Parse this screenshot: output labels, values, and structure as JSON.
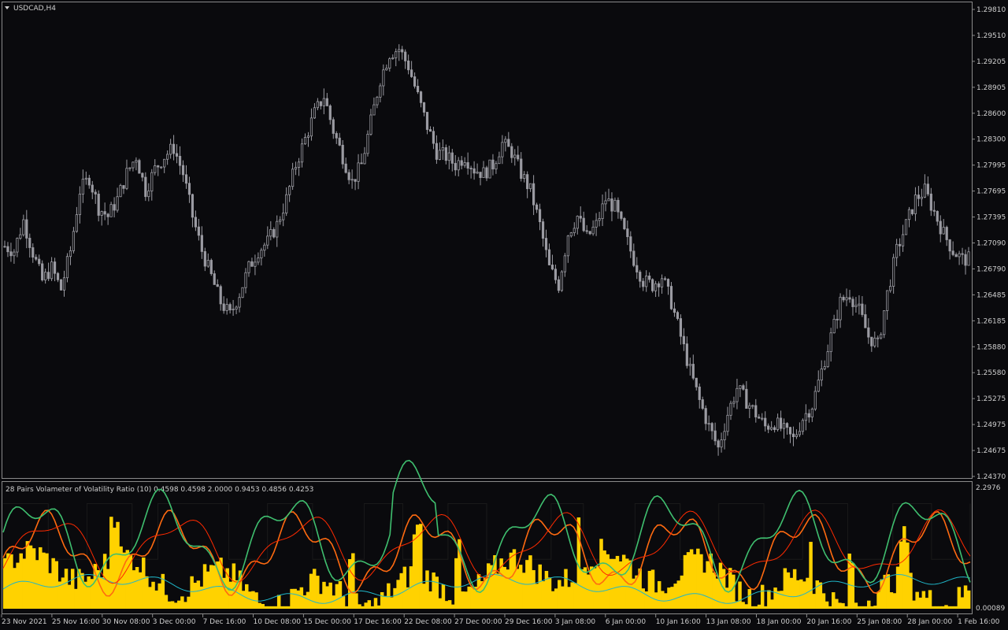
{
  "window": {
    "symbol_label": "USDCAD,H4",
    "menu_icon": "triangle-down-icon"
  },
  "colors": {
    "background": "#0a0a0d",
    "frame": "#8a8a8a",
    "candle": "#9b9ba2",
    "axis_text": "#cfcfcf",
    "histogram": "#ffd200",
    "line_green": "#3fbf6f",
    "line_red": "#ff2a00",
    "line_orange": "#ff6a10",
    "line_cyan": "#1fb6c8",
    "line_black": "#000000"
  },
  "price_panel": {
    "price_labels": [
      "1.29810",
      "1.29510",
      "1.29205",
      "1.28905",
      "1.28600",
      "1.28300",
      "1.27995",
      "1.27695",
      "1.27395",
      "1.27090",
      "1.26790",
      "1.26485",
      "1.26185",
      "1.25880",
      "1.25580",
      "1.25275",
      "1.24975",
      "1.24675",
      "1.24370"
    ]
  },
  "indicator_panel": {
    "title": "28 Pairs Volameter of Volatility Ratio (10) 0.4598 0.4598 2.0000 0.9453 0.4856 0.4253",
    "scale_top": "2.2976",
    "scale_bottom": "0.00089"
  },
  "time_axis": {
    "labels": [
      "23 Nov 2021",
      "25 Nov 16:00",
      "30 Nov 08:00",
      "3 Dec 00:00",
      "7 Dec 16:00",
      "10 Dec 08:00",
      "15 Dec 00:00",
      "17 Dec 16:00",
      "22 Dec 08:00",
      "27 Dec 00:00",
      "29 Dec 16:00",
      "3 Jan 08:00",
      "6 Jan 00:00",
      "10 Jan 16:00",
      "13 Jan 08:00",
      "18 Jan 00:00",
      "20 Jan 16:00",
      "25 Jan 08:00",
      "28 Jan 00:00",
      "1 Feb 16:00"
    ]
  },
  "chart_data": {
    "type": "candlestick",
    "title": "USDCAD,H4",
    "ylim": [
      1.2437,
      1.2981
    ],
    "price_path": [
      [
        0,
        1.2705
      ],
      [
        3,
        1.27
      ],
      [
        6,
        1.2735
      ],
      [
        9,
        1.2698
      ],
      [
        12,
        1.2665
      ],
      [
        15,
        1.268
      ],
      [
        18,
        1.2655
      ],
      [
        21,
        1.27
      ],
      [
        24,
        1.277
      ],
      [
        27,
        1.2785
      ],
      [
        30,
        1.275
      ],
      [
        33,
        1.274
      ],
      [
        36,
        1.276
      ],
      [
        39,
        1.279
      ],
      [
        42,
        1.281
      ],
      [
        45,
        1.277
      ],
      [
        48,
        1.2795
      ],
      [
        51,
        1.281
      ],
      [
        54,
        1.282
      ],
      [
        57,
        1.279
      ],
      [
        60,
        1.274
      ],
      [
        63,
        1.27
      ],
      [
        66,
        1.267
      ],
      [
        69,
        1.264
      ],
      [
        72,
        1.2625
      ],
      [
        75,
        1.265
      ],
      [
        78,
        1.268
      ],
      [
        81,
        1.27
      ],
      [
        84,
        1.271
      ],
      [
        87,
        1.273
      ],
      [
        90,
        1.276
      ],
      [
        93,
        1.28
      ],
      [
        96,
        1.283
      ],
      [
        99,
        1.286
      ],
      [
        102,
        1.288
      ],
      [
        105,
        1.284
      ],
      [
        108,
        1.281
      ],
      [
        111,
        1.278
      ],
      [
        114,
        1.28
      ],
      [
        117,
        1.285
      ],
      [
        120,
        1.29
      ],
      [
        123,
        1.293
      ],
      [
        126,
        1.2935
      ],
      [
        129,
        1.2915
      ],
      [
        132,
        1.288
      ],
      [
        135,
        1.2845
      ],
      [
        138,
        1.2815
      ],
      [
        141,
        1.281
      ],
      [
        144,
        1.28
      ],
      [
        147,
        1.281
      ],
      [
        150,
        1.2795
      ],
      [
        153,
        1.279
      ],
      [
        156,
        1.28
      ],
      [
        159,
        1.2825
      ],
      [
        162,
        1.2815
      ],
      [
        165,
        1.279
      ],
      [
        168,
        1.277
      ],
      [
        171,
        1.273
      ],
      [
        174,
        1.268
      ],
      [
        177,
        1.266
      ],
      [
        180,
        1.272
      ],
      [
        183,
        1.274
      ],
      [
        186,
        1.2715
      ],
      [
        189,
        1.273
      ],
      [
        192,
        1.276
      ],
      [
        195,
        1.275
      ],
      [
        198,
        1.272
      ],
      [
        201,
        1.269
      ],
      [
        204,
        1.2665
      ],
      [
        207,
        1.266
      ],
      [
        210,
        1.267
      ],
      [
        213,
        1.264
      ],
      [
        216,
        1.26
      ],
      [
        219,
        1.256
      ],
      [
        222,
        1.2525
      ],
      [
        225,
        1.2495
      ],
      [
        228,
        1.247
      ],
      [
        231,
        1.251
      ],
      [
        234,
        1.254
      ],
      [
        237,
        1.2525
      ],
      [
        240,
        1.251
      ],
      [
        243,
        1.2495
      ],
      [
        246,
        1.25
      ],
      [
        249,
        1.249
      ],
      [
        252,
        1.248
      ],
      [
        255,
        1.2505
      ],
      [
        258,
        1.252
      ],
      [
        261,
        1.256
      ],
      [
        264,
        1.26
      ],
      [
        267,
        1.264
      ],
      [
        270,
        1.265
      ],
      [
        273,
        1.263
      ],
      [
        276,
        1.26
      ],
      [
        279,
        1.259
      ],
      [
        282,
        1.265
      ],
      [
        285,
        1.27
      ],
      [
        288,
        1.273
      ],
      [
        291,
        1.276
      ],
      [
        294,
        1.277
      ],
      [
        297,
        1.2745
      ],
      [
        300,
        1.272
      ],
      [
        303,
        1.27
      ],
      [
        306,
        1.269
      ],
      [
        308,
        1.269
      ]
    ],
    "indicator_series": [
      {
        "name": "histogram",
        "style": "bars"
      },
      {
        "name": "green",
        "style": "line"
      },
      {
        "name": "red",
        "style": "line"
      },
      {
        "name": "orange",
        "style": "line"
      },
      {
        "name": "cyan",
        "style": "line"
      },
      {
        "name": "black",
        "style": "step"
      }
    ],
    "indicator_ylim": [
      0.00089,
      2.2976
    ]
  }
}
